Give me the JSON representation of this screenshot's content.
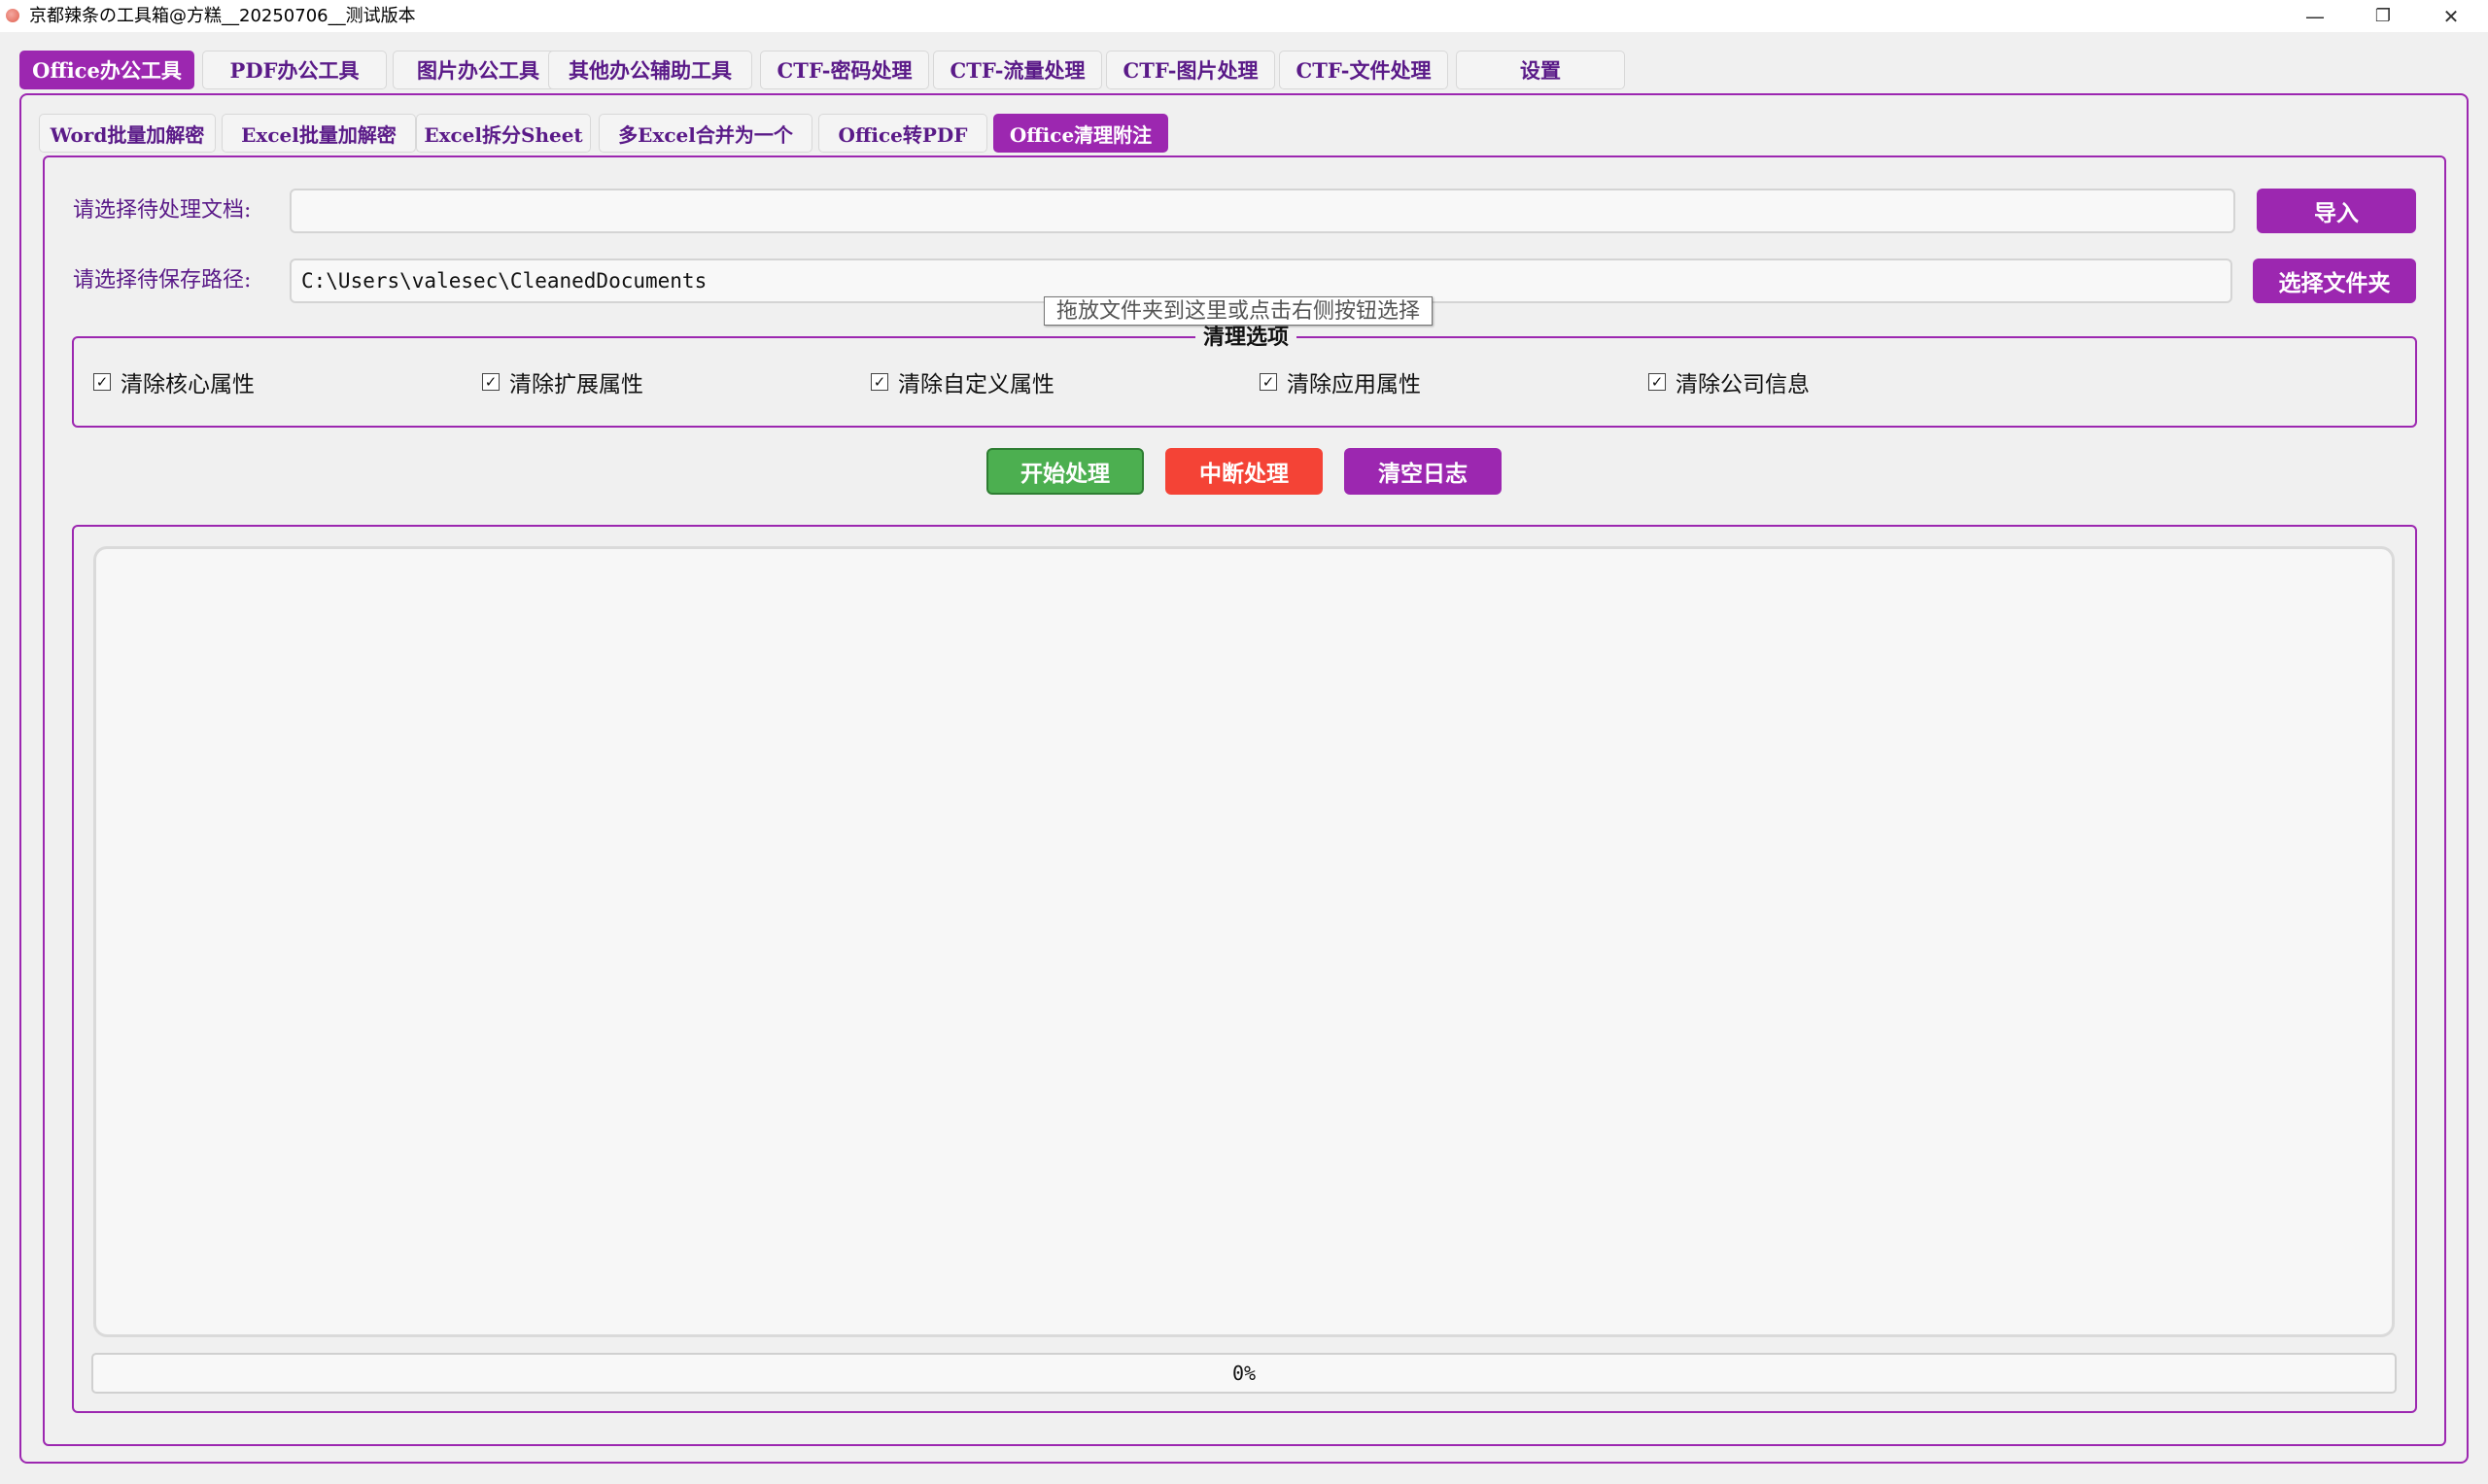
{
  "window": {
    "title": "京都辣条の工具箱@方糕__20250706__测试版本",
    "minimize": "—",
    "restore": "❐",
    "close": "✕"
  },
  "main_tabs": [
    {
      "label": "Office办公工具",
      "active": true
    },
    {
      "label": "PDF办公工具"
    },
    {
      "label": "图片办公工具"
    },
    {
      "label": "其他办公辅助工具"
    },
    {
      "label": "CTF-密码处理"
    },
    {
      "label": "CTF-流量处理"
    },
    {
      "label": "CTF-图片处理"
    },
    {
      "label": "CTF-文件处理"
    },
    {
      "label": "设置"
    }
  ],
  "sub_tabs": [
    {
      "label": "Word批量加解密"
    },
    {
      "label": "Excel批量加解密"
    },
    {
      "label": "Excel拆分Sheet"
    },
    {
      "label": "多Excel合并为一个"
    },
    {
      "label": "Office转PDF"
    },
    {
      "label": "Office清理附注",
      "active": true
    }
  ],
  "form": {
    "doc_label": "请选择待处理文档:",
    "doc_value": "",
    "import_button": "导入",
    "save_label": "请选择待保存路径:",
    "save_value": "C:\\Users\\valesec\\CleanedDocuments",
    "folder_button": "选择文件夹",
    "tooltip": "拖放文件夹到这里或点击右侧按钮选择"
  },
  "options": {
    "title": "清理选项",
    "items": [
      {
        "label": "清除核心属性",
        "checked": true
      },
      {
        "label": "清除扩展属性",
        "checked": true
      },
      {
        "label": "清除自定义属性",
        "checked": true
      },
      {
        "label": "清除应用属性",
        "checked": true
      },
      {
        "label": "清除公司信息",
        "checked": true
      }
    ],
    "check_mark": "✓"
  },
  "actions": {
    "start": "开始处理",
    "stop": "中断处理",
    "clear": "清空日志"
  },
  "progress": {
    "value": 0,
    "text": "0%"
  },
  "colors": {
    "accent": "#9c27b0",
    "start": "#4caf50",
    "stop": "#f44336",
    "clear": "#9c27b0"
  }
}
